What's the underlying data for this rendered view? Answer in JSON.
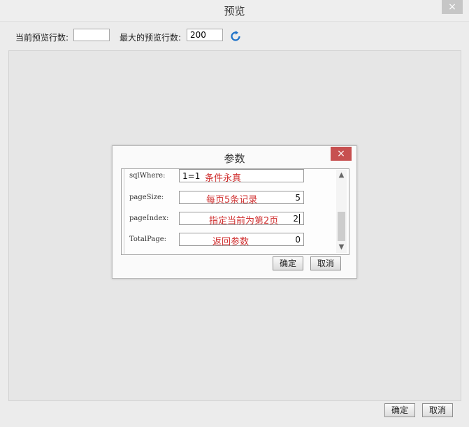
{
  "window": {
    "title": "预览",
    "close_label": "×"
  },
  "toolbar": {
    "current_rows_label": "当前预览行数:",
    "current_rows_value": "",
    "max_rows_label": "最大的预览行数:",
    "max_rows_value": "200",
    "refresh_icon": "refresh-icon"
  },
  "dialog": {
    "title": "参数",
    "close_label": "×",
    "params": [
      {
        "name": "sqlWhere:",
        "value": "1=1",
        "note": "条件永真"
      },
      {
        "name": "pageSize:",
        "value": "5",
        "note": "每页5条记录"
      },
      {
        "name": "pageIndex:",
        "value": "2",
        "note": "指定当前为第2页"
      },
      {
        "name": "TotalPage:",
        "value": "0",
        "note": "返回参数"
      }
    ],
    "ok_label": "确定",
    "cancel_label": "取消"
  },
  "footer": {
    "ok_label": "确定",
    "cancel_label": "取消"
  },
  "colors": {
    "note_red": "#d03030",
    "close_red": "#c75050",
    "refresh_blue": "#1e72c8"
  }
}
